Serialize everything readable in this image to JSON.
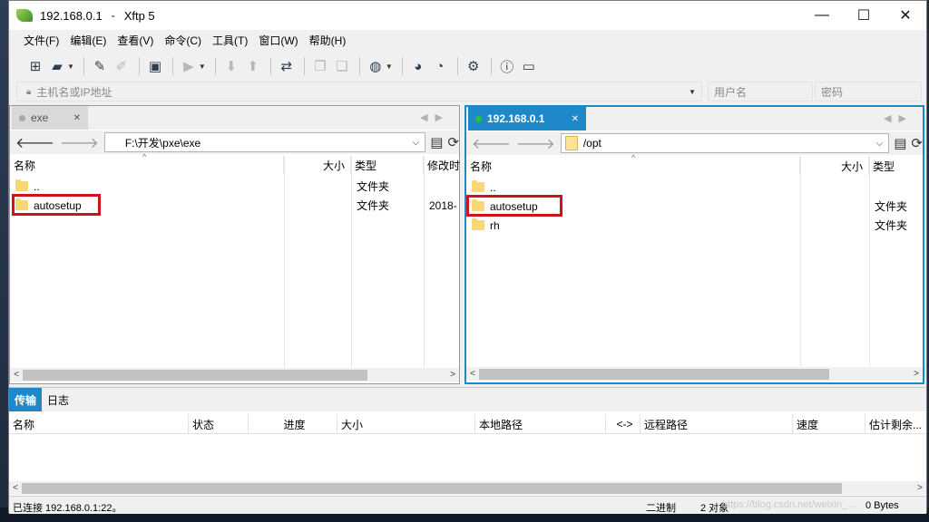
{
  "window": {
    "host": "192.168.0.1",
    "app_name": "Xftp 5",
    "minimize": "—",
    "maximize": "☐",
    "close": "✕"
  },
  "menu": [
    "文件(F)",
    "编辑(E)",
    "查看(V)",
    "命令(C)",
    "工具(T)",
    "窗口(W)",
    "帮助(H)"
  ],
  "address_bar": {
    "host_placeholder": "主机名或IP地址",
    "user_placeholder": "用户名",
    "password_placeholder": "密码"
  },
  "left_pane": {
    "tab_label": "exe",
    "path": "F:\\开发\\pxe\\exe",
    "columns": [
      "名称",
      "大小",
      "类型",
      "修改时"
    ],
    "rows": [
      {
        "name": "..",
        "size": "",
        "type": "文件夹",
        "modified": ""
      },
      {
        "name": "autosetup",
        "size": "",
        "type": "文件夹",
        "modified": "2018-"
      }
    ]
  },
  "right_pane": {
    "tab_label": "192.168.0.1",
    "path": "/opt",
    "columns": [
      "名称",
      "大小",
      "类型"
    ],
    "rows": [
      {
        "name": "..",
        "size": "",
        "type": ""
      },
      {
        "name": "autosetup",
        "size": "",
        "type": "文件夹"
      },
      {
        "name": "rh",
        "size": "",
        "type": "文件夹"
      }
    ]
  },
  "transfer": {
    "tabs": [
      "传输",
      "日志"
    ],
    "columns": [
      "名称",
      "状态",
      "进度",
      "大小",
      "本地路径",
      "<->",
      "远程路径",
      "速度",
      "估计剩余..."
    ]
  },
  "status_bar": {
    "connection": "已连接 192.168.0.1:22。",
    "mode": "二进制",
    "objects": "2 对象",
    "size": "0 Bytes"
  },
  "watermark": "https://blog.csdn.net/weixin_...",
  "colors": {
    "accent": "#1e88c9",
    "highlight_box": "#d0131b",
    "folder": "#f8d775",
    "connected_dot": "#27c23c"
  }
}
